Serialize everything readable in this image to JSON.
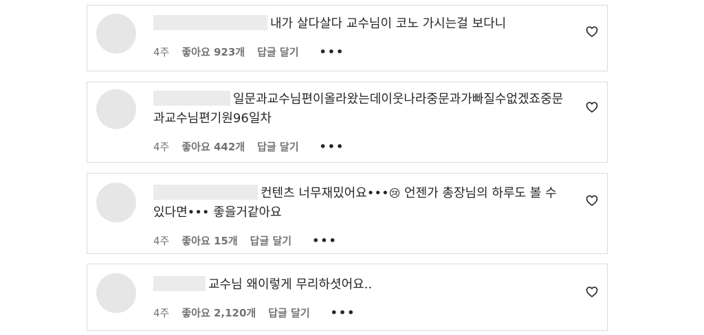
{
  "comments": [
    {
      "text": "내가 살다살다 교수님이 코노 가시는걸 보다니",
      "time": "4주",
      "likes": "좋아요 923개",
      "reply": "답글 달기",
      "more": "•••",
      "like_icon": "heart-outline-icon"
    },
    {
      "text": "일문과교수님편이올라왔는데이웃나라중문과가빠질수없겠죠중문과교수님편기원96일차",
      "time": "4주",
      "likes": "좋아요 442개",
      "reply": "답글 달기",
      "more": "•••",
      "like_icon": "heart-outline-icon"
    },
    {
      "text_before_emoji": "컨텐츠 너무재밌어요•••",
      "emoji": "😢",
      "text_after_emoji": " 언젠가 총장님의 하루도 볼 수있다면••• 좋을거같아요",
      "time": "4주",
      "likes": "좋아요 15개",
      "reply": "답글 달기",
      "more": "•••",
      "like_icon": "heart-outline-icon"
    },
    {
      "text": "교수님 왜이렇게 무리하셧어요..",
      "time": "4주",
      "likes": "좋아요 2,120개",
      "reply": "답글 달기",
      "more": "•••",
      "like_icon": "heart-outline-icon"
    }
  ]
}
